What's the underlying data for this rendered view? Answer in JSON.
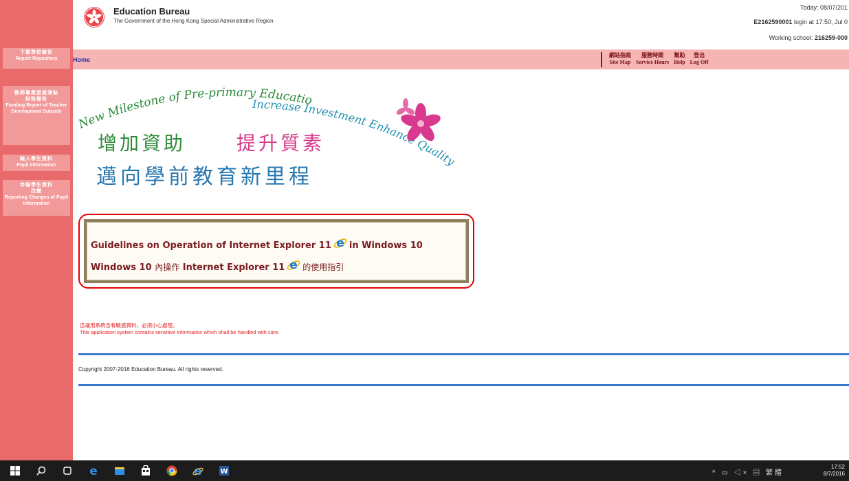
{
  "header": {
    "org_name": "Education Bureau",
    "org_sub": "The Government of the Hong Kong Special Administrative Region",
    "today": "Today: 08/07/201",
    "login_user": "E2162590001",
    "login_text": " login at 17:50, Jul 0",
    "school_label": "Working school: ",
    "school_code": "216259-000"
  },
  "nav": {
    "home": "Home",
    "links": [
      {
        "zh": "網站指南",
        "en": "Site Map"
      },
      {
        "zh": "服務時間",
        "en": "Service Hours"
      },
      {
        "zh": "幫助",
        "en": "Help"
      },
      {
        "zh": "登出",
        "en": "Log Off"
      }
    ]
  },
  "sidebar": {
    "items": [
      {
        "zh": "下載學校報告",
        "en": "Report Repository"
      },
      {
        "zh": "教師專業發展津貼",
        "zh2": "財政報告",
        "en": "Funding Report of Teacher Development Subsidy"
      },
      {
        "zh": "輸入學生資料",
        "en": "Pupil Information"
      },
      {
        "zh": "申報學生資料",
        "zh2": "改變",
        "en": "Reporting Changes of Pupil Information"
      }
    ]
  },
  "banner": {
    "en_line1": "New Milestone of Pre-primary Education",
    "en_line2": "Increase Investment Enhance Quality",
    "zh_line1a": "增加資助",
    "zh_line1b": "提升質素",
    "zh_line2": "邁向學前教育新里程"
  },
  "notice": {
    "line1_pre": "Guidelines on Operation of Internet Explorer 11",
    "line1_post": "in Windows 10",
    "line2_a": "Windows 10",
    "line2_b": "內操作",
    "line2_c": "Internet Explorer 11",
    "line2_d": "的使用指引"
  },
  "warning": {
    "zh": "這運用系統含有敏感資料，必須小心處理。",
    "en": "This application system contains sensitive information which shall be handled with care."
  },
  "footer": {
    "copyright": "Copyright 2007-2016 Education Bureau. All rights reserved."
  },
  "taskbar": {
    "icons": [
      "windows-start-icon",
      "search-icon",
      "task-view-icon",
      "edge-icon",
      "file-explorer-icon",
      "store-icon",
      "chrome-icon",
      "internet-explorer-icon",
      "word-icon"
    ],
    "ime": "繁體",
    "time": "17:52",
    "date": "8/7/2016"
  },
  "colors": {
    "sidebar": "#e86a6a",
    "navbar": "#f5b5b5",
    "warning": "#e02020",
    "divider": "#3a78d0"
  }
}
